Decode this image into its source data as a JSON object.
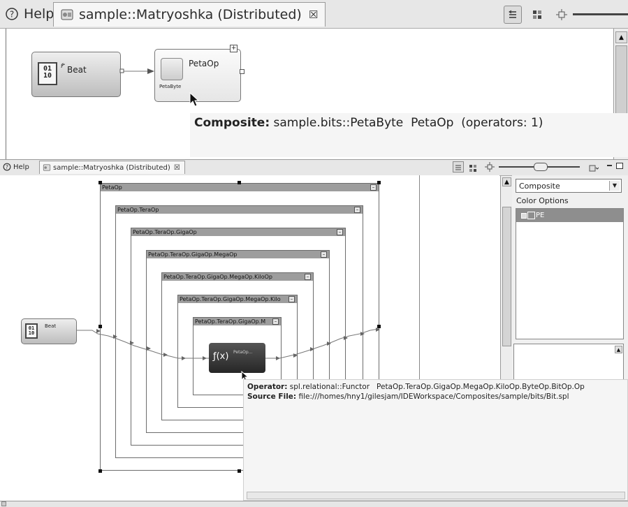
{
  "top": {
    "tabs": [
      {
        "label": "Help",
        "icon": "help-icon"
      },
      {
        "label": "sample::Matryoshka (Distributed)",
        "icon": "application-icon",
        "close": "☒"
      }
    ],
    "nodes": {
      "beat": {
        "label": "Beat",
        "bits": [
          "01",
          "10"
        ]
      },
      "petaop": {
        "label": "PetaOp",
        "sublabel": "PetaByte",
        "expand": "+"
      }
    },
    "tooltip": {
      "kind": "Composite:",
      "text": "sample.bits::PetaByte  PetaOp  (operators: 1)"
    }
  },
  "bottom": {
    "tabs": [
      {
        "label": "Help",
        "icon": "help-icon"
      },
      {
        "label": "sample::Matryoshka (Distributed)",
        "icon": "application-icon",
        "close": "☒"
      }
    ],
    "composites": [
      "PetaOp",
      "PetaOp.TeraOp",
      "PetaOp.TeraOp.GigaOp",
      "PetaOp.TeraOp.GigaOp.MegaOp",
      "PetaOp.TeraOp.GigaOp.MegaOp.KiloOp",
      "PetaOp.TeraOp.GigaOp.MegaOp.Kilo",
      "PetaOp.TeraOp.GigaOp.M"
    ],
    "beat": {
      "label": "Beat",
      "bits": [
        "01",
        "10"
      ]
    },
    "functor": {
      "symbol": "ƒ(x)",
      "label": "PetaOp..."
    },
    "right_panel": {
      "combo_value": "Composite",
      "color_options_label": "Color Options",
      "items": [
        {
          "label": "PE",
          "checked": true
        }
      ]
    },
    "tooltip": {
      "operator_key": "Operator:",
      "operator_value": "spl.relational::Functor   PetaOp.TeraOp.GigaOp.MegaOp.KiloOp.ByteOp.BitOp.Op",
      "source_key": "Source File:",
      "source_value": "file:///homes/hny1/gilesjam/IDEWorkspace/Composites/sample/bits/Bit.spl"
    }
  }
}
